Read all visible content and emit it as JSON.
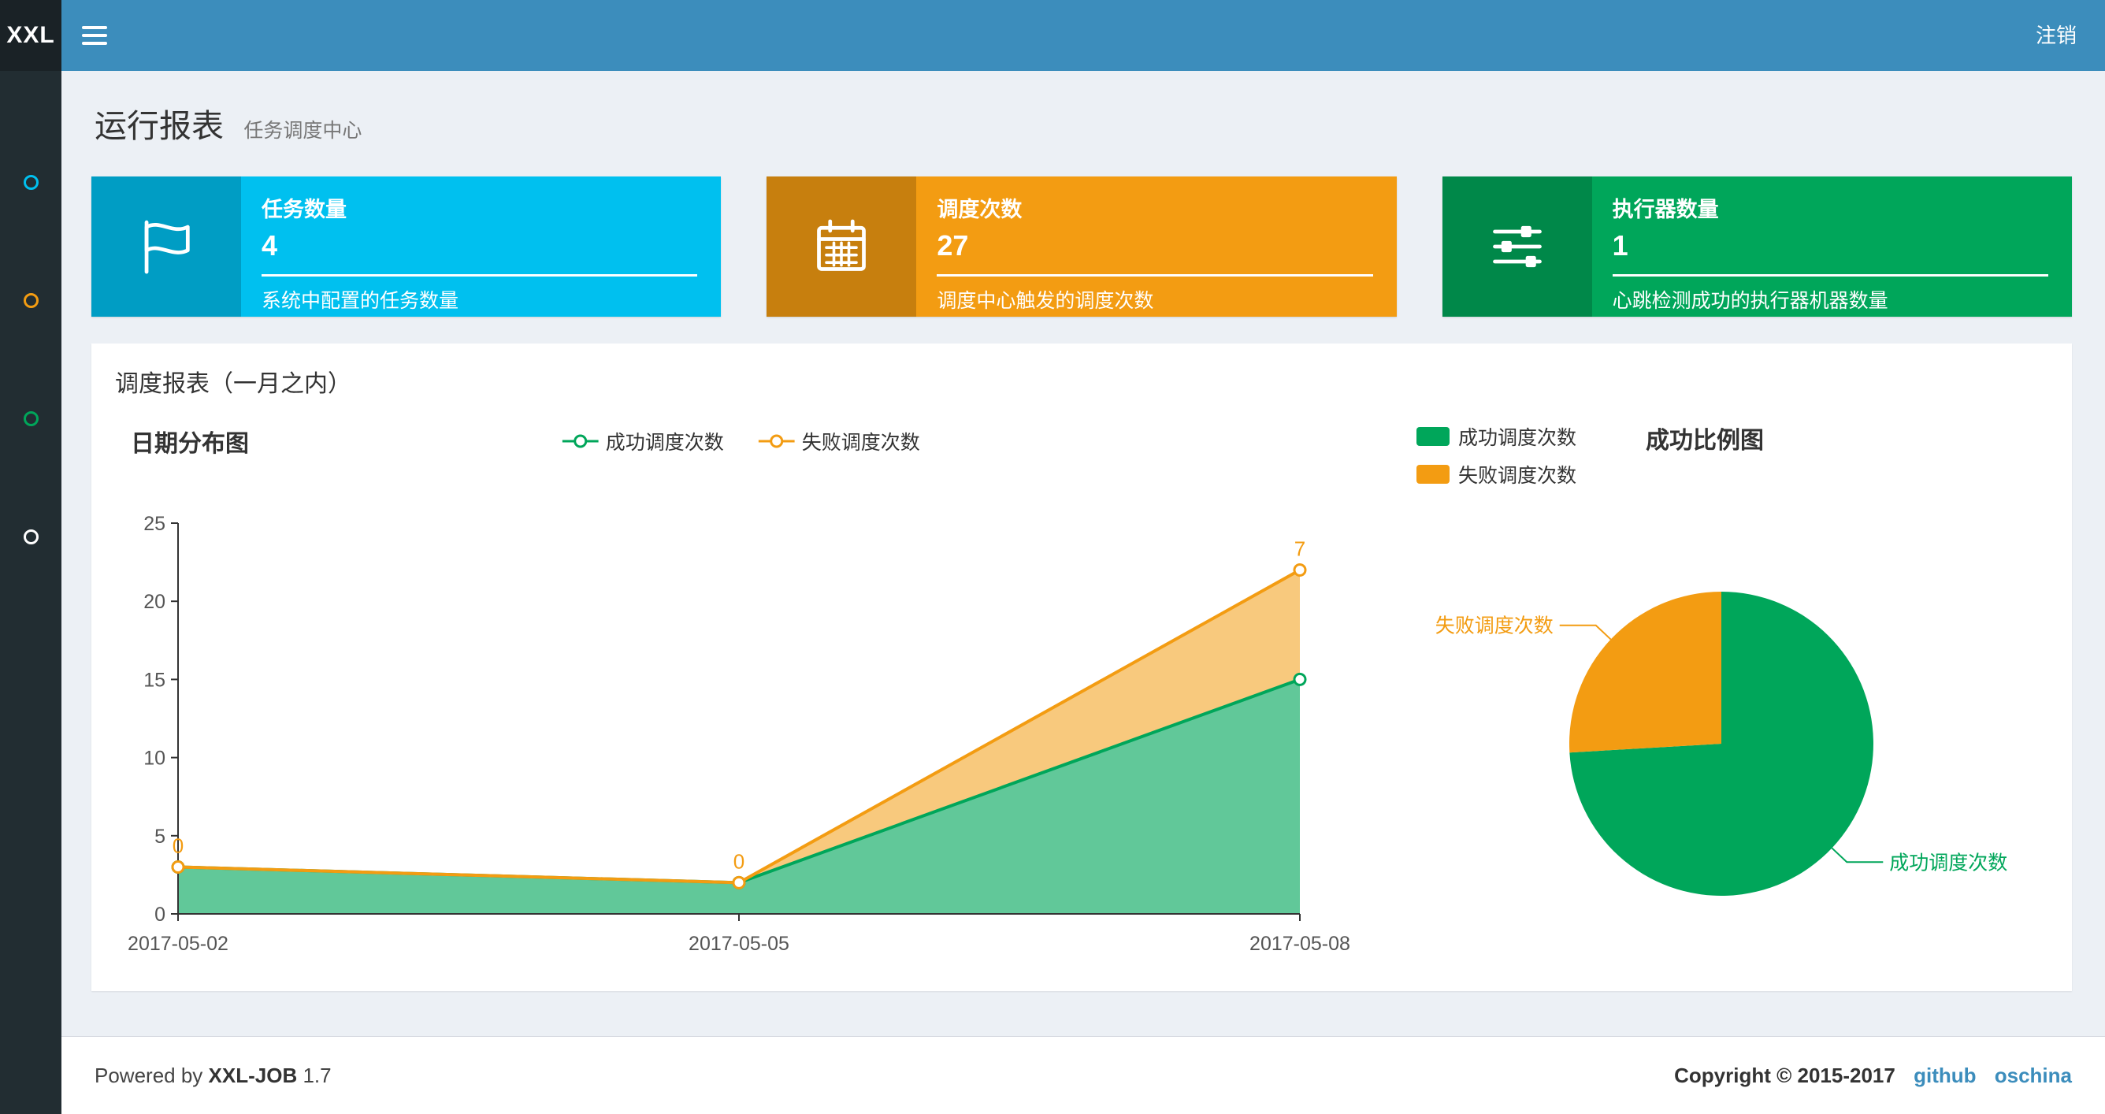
{
  "navbar": {
    "logo": "XXL",
    "logout": "注销"
  },
  "sidebar": {
    "items": [
      {
        "name": "run-report",
        "icon": "circle-icon",
        "color": "#00c0ef"
      },
      {
        "name": "task-manage",
        "icon": "circle-icon",
        "color": "#f39c12"
      },
      {
        "name": "dispatch-log",
        "icon": "circle-icon",
        "color": "#00a65a"
      },
      {
        "name": "executor-manage",
        "icon": "circle-icon",
        "color": "#ffffff"
      }
    ]
  },
  "page_header": {
    "title": "运行报表",
    "subtitle": "任务调度中心"
  },
  "info_boxes": [
    {
      "title": "任务数量",
      "value": "4",
      "desc": "系统中配置的任务数量",
      "color": "#00c0ef",
      "icon": "flag-icon"
    },
    {
      "title": "调度次数",
      "value": "27",
      "desc": "调度中心触发的调度次数",
      "color": "#f39c12",
      "icon": "calendar-icon"
    },
    {
      "title": "执行器数量",
      "value": "1",
      "desc": "心跳检测成功的执行器机器数量",
      "color": "#00a65a",
      "icon": "sliders-icon"
    }
  ],
  "panel": {
    "title": "调度报表（一月之内）"
  },
  "chart_data": [
    {
      "type": "area",
      "stacked": true,
      "title": "日期分布图",
      "x": [
        "2017-05-02",
        "2017-05-05",
        "2017-05-08"
      ],
      "series": [
        {
          "name": "成功调度次数",
          "color": "#00a65a",
          "values": [
            3,
            2,
            15
          ]
        },
        {
          "name": "失败调度次数",
          "color": "#f39c12",
          "values": [
            0,
            0,
            7
          ]
        }
      ],
      "point_labels_series": "失败调度次数",
      "ylim": [
        0,
        25
      ],
      "yticks": [
        0,
        5,
        10,
        15,
        20,
        25
      ],
      "legend_position": "top",
      "grid": false
    },
    {
      "type": "pie",
      "title": "成功比例图",
      "slices": [
        {
          "name": "成功调度次数",
          "value": 20,
          "color": "#00a65a"
        },
        {
          "name": "失败调度次数",
          "value": 7,
          "color": "#f39c12"
        }
      ],
      "legend_position": "top-left"
    }
  ],
  "footer": {
    "powered_prefix": "Powered by",
    "product": "XXL-JOB",
    "version": "1.7",
    "copyright": "Copyright © 2015-2017",
    "links": [
      "github",
      "oschina"
    ]
  }
}
